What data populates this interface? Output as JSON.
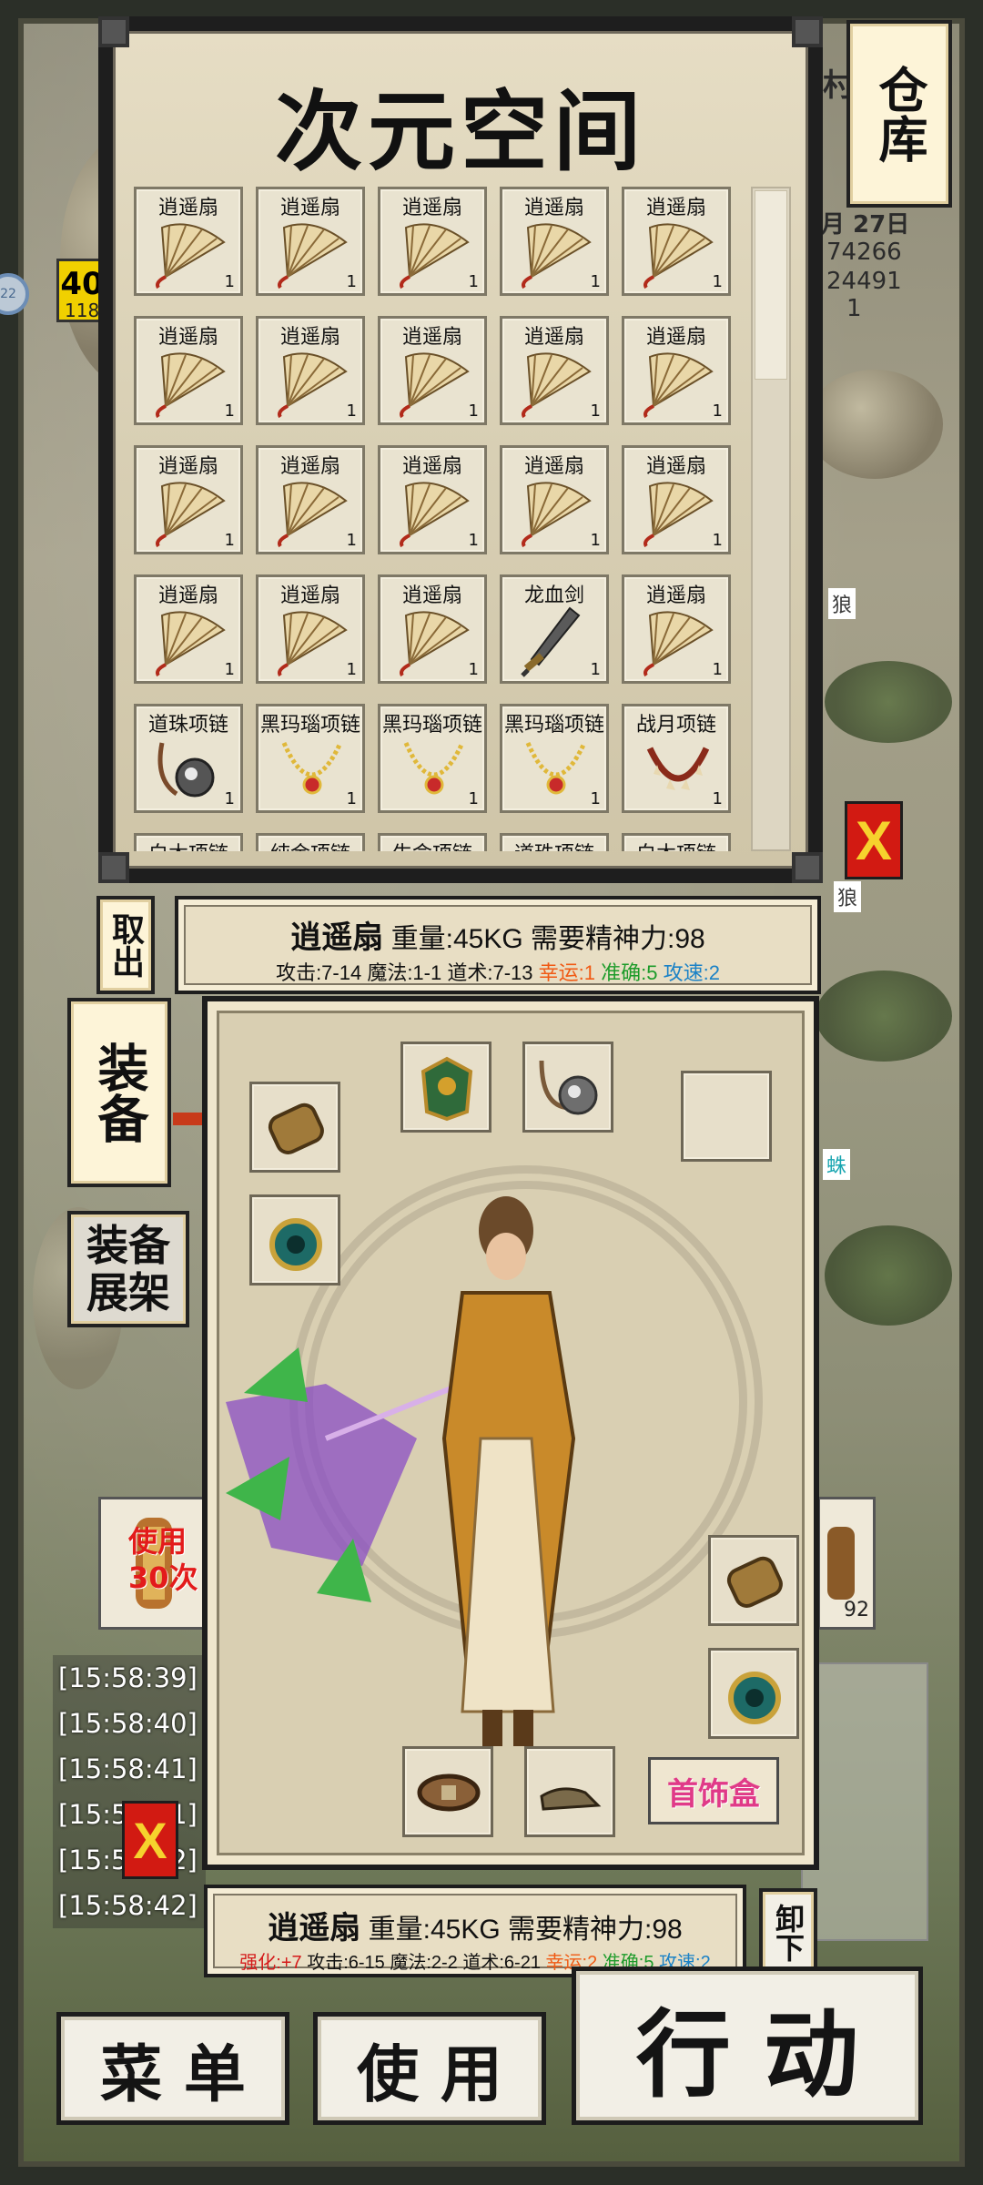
{
  "storage": {
    "title": "次元空间",
    "button_label": "仓库",
    "withdraw_label": "取出",
    "close_label": "X",
    "rows": [
      [
        {
          "name": "逍遥扇",
          "count": "1",
          "icon": "fan-icon"
        },
        {
          "name": "逍遥扇",
          "count": "1",
          "icon": "fan-icon"
        },
        {
          "name": "逍遥扇",
          "count": "1",
          "icon": "fan-icon"
        },
        {
          "name": "逍遥扇",
          "count": "1",
          "icon": "fan-icon"
        },
        {
          "name": "逍遥扇",
          "count": "1",
          "icon": "fan-icon"
        }
      ],
      [
        {
          "name": "逍遥扇",
          "count": "1",
          "icon": "fan-icon"
        },
        {
          "name": "逍遥扇",
          "count": "1",
          "icon": "fan-icon"
        },
        {
          "name": "逍遥扇",
          "count": "1",
          "icon": "fan-icon"
        },
        {
          "name": "逍遥扇",
          "count": "1",
          "icon": "fan-icon"
        },
        {
          "name": "逍遥扇",
          "count": "1",
          "icon": "fan-icon"
        }
      ],
      [
        {
          "name": "逍遥扇",
          "count": "1",
          "icon": "fan-icon"
        },
        {
          "name": "逍遥扇",
          "count": "1",
          "icon": "fan-icon"
        },
        {
          "name": "逍遥扇",
          "count": "1",
          "icon": "fan-icon"
        },
        {
          "name": "逍遥扇",
          "count": "1",
          "icon": "fan-icon"
        },
        {
          "name": "逍遥扇",
          "count": "1",
          "icon": "fan-icon"
        }
      ],
      [
        {
          "name": "逍遥扇",
          "count": "1",
          "icon": "fan-icon"
        },
        {
          "name": "逍遥扇",
          "count": "1",
          "icon": "fan-icon"
        },
        {
          "name": "逍遥扇",
          "count": "1",
          "icon": "fan-icon"
        },
        {
          "name": "龙血剑",
          "count": "1",
          "icon": "sword-icon"
        },
        {
          "name": "逍遥扇",
          "count": "1",
          "icon": "fan-icon"
        }
      ],
      [
        {
          "name": "道珠项链",
          "count": "1",
          "icon": "bead-necklace-icon"
        },
        {
          "name": "黑玛瑙项链",
          "count": "1",
          "icon": "agate-necklace-icon"
        },
        {
          "name": "黑玛瑙项链",
          "count": "1",
          "icon": "agate-necklace-icon"
        },
        {
          "name": "黑玛瑙项链",
          "count": "1",
          "icon": "agate-necklace-icon"
        },
        {
          "name": "战月项链",
          "count": "1",
          "icon": "fang-necklace-icon"
        }
      ],
      [
        {
          "name": "白木项链",
          "count": "",
          "icon": "necklace-icon"
        },
        {
          "name": "纯金项链",
          "count": "",
          "icon": "necklace-icon"
        },
        {
          "name": "生命项链",
          "count": "",
          "icon": "necklace-icon"
        },
        {
          "name": "道珠项链",
          "count": "",
          "icon": "necklace-icon"
        },
        {
          "name": "白木项链",
          "count": "",
          "icon": "necklace-icon"
        }
      ]
    ]
  },
  "selected_item": {
    "name": "逍遥扇",
    "line1_rest": " 重量:45KG 需要精神力:98",
    "stats": "攻击:7-14 魔法:1-1 道术:7-13 ",
    "luck": "幸运:1",
    "accuracy": "准确:5",
    "speed": "攻速:2"
  },
  "equipment": {
    "button_label": "装备",
    "shelf_label": "装备展架",
    "jewel_box_label": "首饰盒",
    "unequip_label": "卸下",
    "item": {
      "name": "逍遥扇",
      "line1_rest": " 重量:45KG 需要精神力:98",
      "enhance": "强化:+7",
      "stats": " 攻击:6-15 魔法:2-2 道术:6-21 ",
      "luck": "幸运:2",
      "accuracy": "准确:5",
      "speed": "攻速:2"
    }
  },
  "hud": {
    "date": "月 27日",
    "stat_a": "74266",
    "stat_b": "24491",
    "stat_c": "1",
    "level": "40",
    "sub_level": "118",
    "badge": "22",
    "name_tag_1": "狼",
    "name_tag_2": "狼",
    "name_tag_3": "蛛",
    "top_right_text": "村"
  },
  "quick_item": {
    "label": "使用30次",
    "right_count": "92"
  },
  "chat": [
    "[15:58:39]",
    "[15:58:40]",
    "[15:58:41]",
    "[15:58:41]",
    "[15:58:42]",
    "[15:58:42]"
  ],
  "chat_close_label": "X",
  "bottom": {
    "menu": "菜 单",
    "use": "使 用",
    "action": "行 动"
  }
}
